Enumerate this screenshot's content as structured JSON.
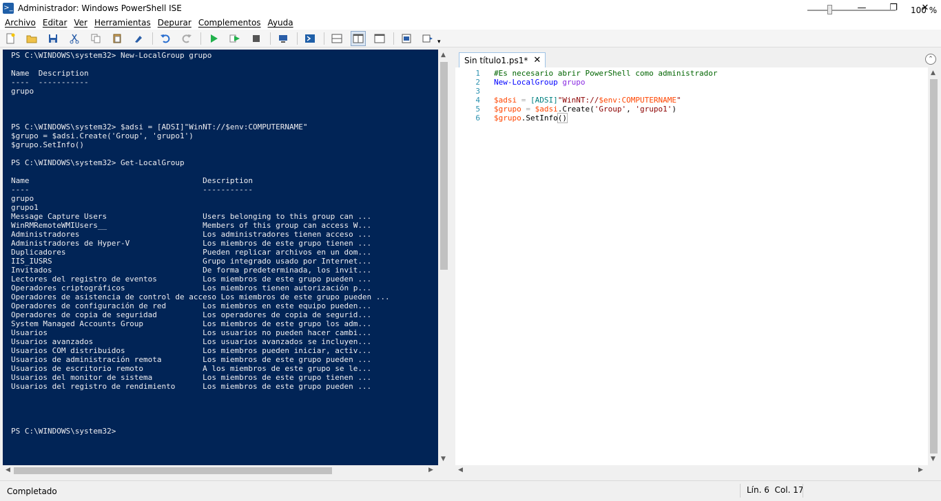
{
  "window": {
    "title": "Administrador: Windows PowerShell ISE",
    "minimize": "—",
    "maximize": "❐",
    "close": "✕"
  },
  "menu": [
    "Archivo",
    "Editar",
    "Ver",
    "Herramientas",
    "Depurar",
    "Complementos",
    "Ayuda"
  ],
  "toolbar": {
    "icons": [
      "new-icon",
      "open-icon",
      "save-icon",
      "cut-icon",
      "copy-icon",
      "paste-icon",
      "clear-console-icon",
      "undo-icon",
      "redo-icon",
      "run-icon",
      "run-selection-icon",
      "stop-icon",
      "remote-powershell-icon",
      "powershell-icon",
      "layout-top-icon",
      "layout-right-icon",
      "layout-max-icon",
      "show-command-icon",
      "show-addon-icon"
    ],
    "colors": {
      "run": "#22b14c",
      "stop": "#555555",
      "accent": "#1f5fa8"
    }
  },
  "console": {
    "background": "#012456",
    "lines": [
      "PS C:\\WINDOWS\\system32> New-LocalGroup grupo",
      "",
      "Name  Description",
      "----  -----------",
      "grupo",
      "",
      "",
      "",
      "PS C:\\WINDOWS\\system32> $adsi = [ADSI]\"WinNT://$env:COMPUTERNAME\"",
      "$grupo = $adsi.Create('Group', 'grupo1')",
      "$grupo.SetInfo()",
      "",
      "PS C:\\WINDOWS\\system32> Get-LocalGroup",
      "",
      "Name                                      Description",
      "----                                      -----------",
      "grupo",
      "grupo1",
      "Message Capture Users                     Users belonging to this group can ...",
      "WinRMRemoteWMIUsers__                     Members of this group can access W...",
      "Administradores                           Los administradores tienen acceso ...",
      "Administradores de Hyper-V                Los miembros de este grupo tienen ...",
      "Duplicadores                              Pueden replicar archivos en un dom...",
      "IIS_IUSRS                                 Grupo integrado usado por Internet...",
      "Invitados                                 De forma predeterminada, los invit...",
      "Lectores del registro de eventos          Los miembros de este grupo pueden ...",
      "Operadores criptográficos                 Los miembros tienen autorización p...",
      "Operadores de asistencia de control de acceso Los miembros de este grupo pueden ...",
      "Operadores de configuración de red        Los miembros en este equipo pueden...",
      "Operadores de copia de seguridad          Los operadores de copia de segurid...",
      "System Managed Accounts Group             Los miembros de este grupo los adm...",
      "Usuarios                                  Los usuarios no pueden hacer cambi...",
      "Usuarios avanzados                        Los usuarios avanzados se incluyen...",
      "Usuarios COM distribuidos                 Los miembros pueden iniciar, activ...",
      "Usuarios de administración remota         Los miembros de este grupo pueden ...",
      "Usuarios de escritorio remoto             A los miembros de este grupo se le...",
      "Usuarios del monitor de sistema           Los miembros de este grupo tienen ...",
      "Usuarios del registro de rendimiento      Los miembros de este grupo pueden ...",
      "",
      "",
      "",
      "",
      "PS C:\\WINDOWS\\system32>"
    ]
  },
  "editor": {
    "tab_label": "Sin título1.ps1*",
    "tab_close": "✕",
    "collapse": "⌃",
    "line_numbers": [
      "1",
      "2",
      "3",
      "4",
      "5",
      "6"
    ],
    "code": [
      [
        {
          "t": "#Es necesario abrir PowerShell como administrador",
          "k": "comment"
        }
      ],
      [
        {
          "t": "New-LocalGroup",
          "k": "cmd"
        },
        {
          "t": " ",
          "k": "mem"
        },
        {
          "t": "grupo",
          "k": "arg"
        }
      ],
      [],
      [
        {
          "t": "$adsi",
          "k": "var"
        },
        {
          "t": " = ",
          "k": "op"
        },
        {
          "t": "[ADSI]",
          "k": "type"
        },
        {
          "t": "\"WinNT://",
          "k": "str"
        },
        {
          "t": "$env:COMPUTERNAME",
          "k": "var"
        },
        {
          "t": "\"",
          "k": "str"
        }
      ],
      [
        {
          "t": "$grupo",
          "k": "var"
        },
        {
          "t": " = ",
          "k": "op"
        },
        {
          "t": "$adsi",
          "k": "var"
        },
        {
          "t": ".Create(",
          "k": "mem"
        },
        {
          "t": "'Group'",
          "k": "str"
        },
        {
          "t": ", ",
          "k": "mem"
        },
        {
          "t": "'grupo1'",
          "k": "str"
        },
        {
          "t": ")",
          "k": "mem"
        }
      ],
      [
        {
          "t": "$grupo",
          "k": "var"
        },
        {
          "t": ".SetInfo",
          "k": "mem"
        },
        {
          "t": "()",
          "k": "paren"
        }
      ]
    ]
  },
  "status": {
    "text": "Completado",
    "position": "Lín. 6  Col. 17",
    "zoom": "100 %",
    "zoom_level_percent": 100
  }
}
